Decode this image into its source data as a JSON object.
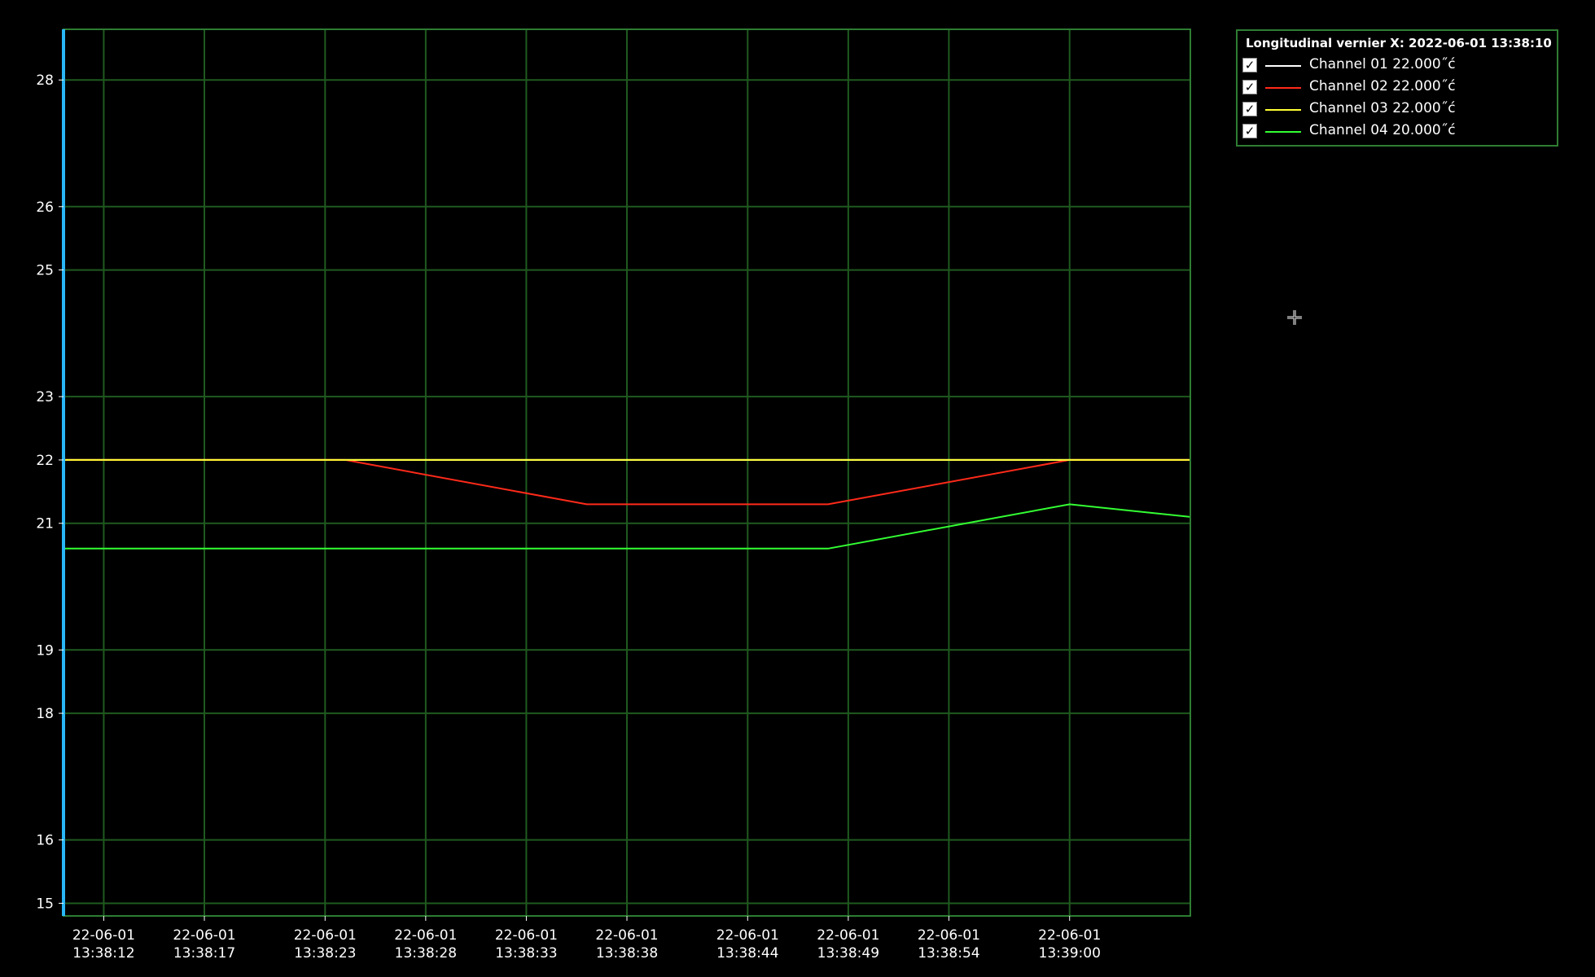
{
  "chart_data": {
    "type": "line",
    "title": "",
    "xlabel": "",
    "ylabel": "",
    "grid": true,
    "legend_placement": "top-right",
    "ylim": [
      14.8,
      28.8
    ],
    "xlim": [
      "2022-06-01 13:38:10",
      "2022-06-01 13:39:06"
    ],
    "y_ticks": [
      "15",
      "16",
      "18",
      "19",
      "21",
      "22",
      "23",
      "25",
      "26",
      "28"
    ],
    "y_tick_values": [
      15,
      16,
      18,
      19,
      21,
      22,
      23,
      25,
      26,
      28
    ],
    "x_ticks": [
      {
        "line1": "22-06-01",
        "line2": "13:38:12",
        "t": "2022-06-01 13:38:12"
      },
      {
        "line1": "22-06-01",
        "line2": "13:38:17",
        "t": "2022-06-01 13:38:17"
      },
      {
        "line1": "22-06-01",
        "line2": "13:38:23",
        "t": "2022-06-01 13:38:23"
      },
      {
        "line1": "22-06-01",
        "line2": "13:38:28",
        "t": "2022-06-01 13:38:28"
      },
      {
        "line1": "22-06-01",
        "line2": "13:38:33",
        "t": "2022-06-01 13:38:33"
      },
      {
        "line1": "22-06-01",
        "line2": "13:38:38",
        "t": "2022-06-01 13:38:38"
      },
      {
        "line1": "22-06-01",
        "line2": "13:38:44",
        "t": "2022-06-01 13:38:44"
      },
      {
        "line1": "22-06-01",
        "line2": "13:38:49",
        "t": "2022-06-01 13:38:49"
      },
      {
        "line1": "22-06-01",
        "line2": "13:38:54",
        "t": "2022-06-01 13:38:54"
      },
      {
        "line1": "22-06-01",
        "line2": "13:39:00",
        "t": "2022-06-01 13:39:00"
      }
    ],
    "series": [
      {
        "name": "Channel 01",
        "color": "#ffffff",
        "points": [
          {
            "x": "2022-06-01 13:38:10",
            "y": 22.0
          },
          {
            "x": "2022-06-01 13:39:06",
            "y": 22.0
          }
        ]
      },
      {
        "name": "Channel 02",
        "color": "#ff2a1a",
        "points": [
          {
            "x": "2022-06-01 13:38:10",
            "y": 22.0
          },
          {
            "x": "2022-06-01 13:38:24",
            "y": 22.0
          },
          {
            "x": "2022-06-01 13:38:36",
            "y": 21.3
          },
          {
            "x": "2022-06-01 13:38:48",
            "y": 21.3
          },
          {
            "x": "2022-06-01 13:39:00",
            "y": 22.0
          },
          {
            "x": "2022-06-01 13:39:06",
            "y": 22.0
          }
        ]
      },
      {
        "name": "Channel 03",
        "color": "#ffff33",
        "points": [
          {
            "x": "2022-06-01 13:38:10",
            "y": 22.0
          },
          {
            "x": "2022-06-01 13:39:06",
            "y": 22.0
          }
        ]
      },
      {
        "name": "Channel 04",
        "color": "#33ff33",
        "points": [
          {
            "x": "2022-06-01 13:38:10",
            "y": 20.6
          },
          {
            "x": "2022-06-01 13:38:48",
            "y": 20.6
          },
          {
            "x": "2022-06-01 13:39:00",
            "y": 21.3
          },
          {
            "x": "2022-06-01 13:39:06",
            "y": 21.1
          }
        ]
      }
    ]
  },
  "legend": {
    "title": "Longitudinal vernier X: 2022-06-01 13:38:10",
    "items": [
      {
        "label": "Channel 01 22.000˝ć",
        "checked": true,
        "color": "#ffffff"
      },
      {
        "label": "Channel 02 22.000˝ć",
        "checked": true,
        "color": "#ff2a1a"
      },
      {
        "label": "Channel 03 22.000˝ć",
        "checked": true,
        "color": "#ffff33"
      },
      {
        "label": "Channel 04 20.000˝ć",
        "checked": true,
        "color": "#33ff33"
      }
    ]
  },
  "colors": {
    "background": "#000000",
    "grid": "#1f5a1f",
    "frame": "#2e7d32",
    "vernier": "#29b6f6",
    "text": "#ffffff"
  },
  "cursor": {
    "icon": "crosshair-move-icon"
  }
}
